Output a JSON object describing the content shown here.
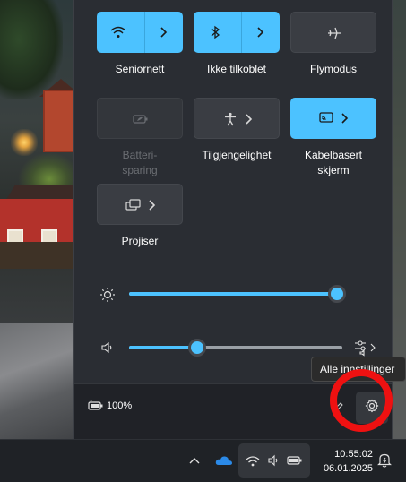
{
  "quick_settings": {
    "tiles": [
      {
        "label": "Seniornett",
        "icon": "wifi-icon",
        "state": "on",
        "has_chevron": true
      },
      {
        "label": "Ikke tilkoblet",
        "icon": "bluetooth-icon",
        "state": "on",
        "has_chevron": true
      },
      {
        "label": "Flymodus",
        "icon": "airplane-icon",
        "state": "off",
        "has_chevron": false
      },
      {
        "label_line1": "Batteri-",
        "label_line2": "sparing",
        "icon": "battery-saver-icon",
        "state": "disabled",
        "has_chevron": false
      },
      {
        "label": "Tilgjengelighet",
        "icon": "accessibility-icon",
        "state": "off",
        "has_chevron": true
      },
      {
        "label_line1": "Kabelbasert",
        "label_line2": "skjerm",
        "icon": "cast-icon",
        "state": "on",
        "has_chevron": true
      },
      {
        "label": "Projiser",
        "icon": "project-icon",
        "state": "off",
        "has_chevron": true
      }
    ],
    "brightness": {
      "icon": "brightness-icon",
      "value": 1.0
    },
    "volume": {
      "icon": "speaker-icon",
      "value": 0.32,
      "mixer_icon": "volume-mixer-icon"
    },
    "footer": {
      "battery_icon": "battery-charging-icon",
      "battery_percent": "100%",
      "edit_icon": "pencil-icon",
      "settings_icon": "gear-icon",
      "tooltip": "Alle innstillinger"
    }
  },
  "taskbar": {
    "chevron_icon": "chevron-up-icon",
    "onedrive_icon": "onedrive-icon",
    "tray_icons": [
      "wifi-icon",
      "speaker-icon",
      "battery-charging-icon"
    ],
    "time": "10:55:02",
    "date": "06.01.2025",
    "notification_icon": "notification-bell-icon"
  },
  "colors": {
    "accent": "#4cc2ff",
    "panel_bg": "#2a2d33",
    "highlight_ring": "#ee1111"
  }
}
